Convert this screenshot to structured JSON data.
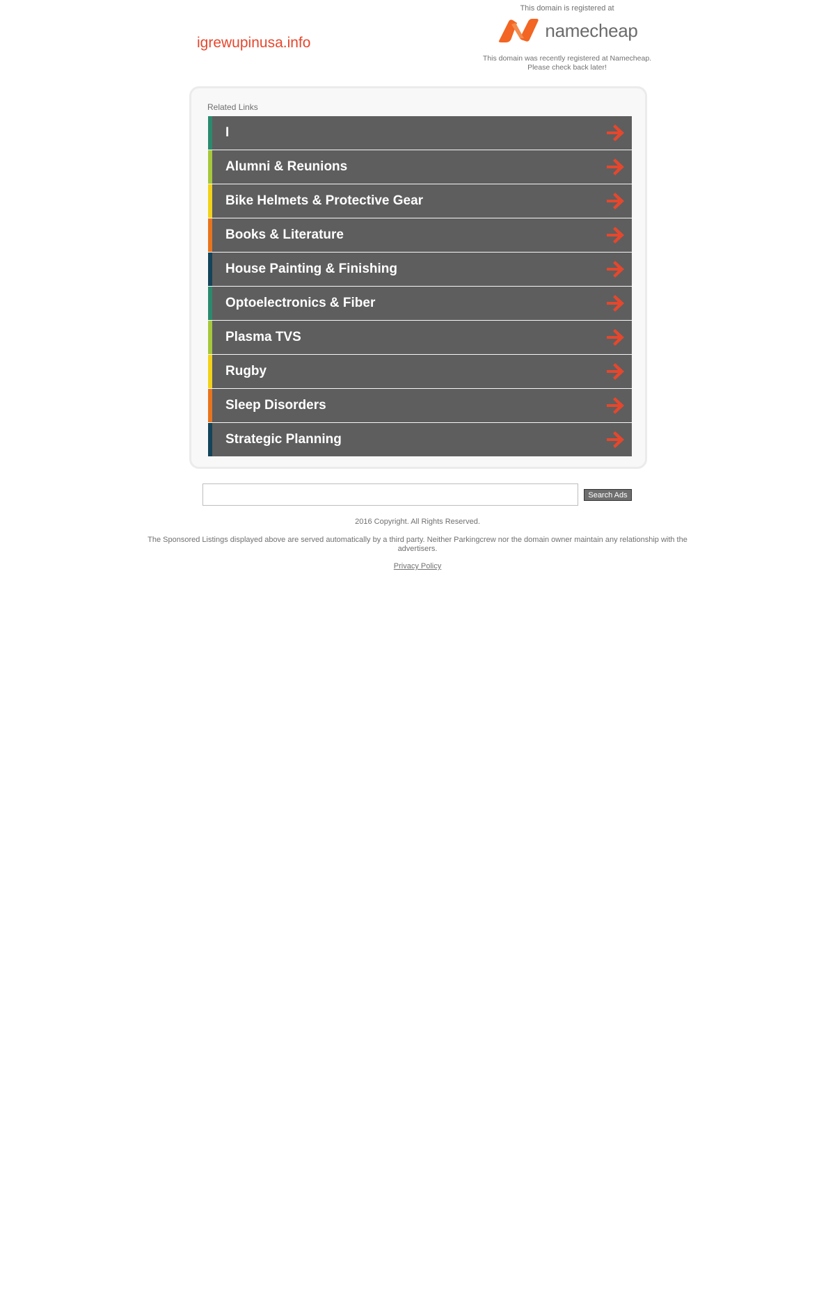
{
  "header": {
    "domain": "igrewupinusa.info",
    "registered_at": "This domain is registered at",
    "registrar_name": "namecheap",
    "notice_line1": "This domain was recently registered at Namecheap.",
    "notice_line2": "Please check back later!",
    "logo_icon": "namecheap-n-logo",
    "logo_color": "#f26522"
  },
  "related": {
    "title": "Related Links",
    "arrow_icon": "arrow-right-icon",
    "arrow_color": "#e5472d",
    "items": [
      {
        "label": "I",
        "color": "#2b8a6e"
      },
      {
        "label": "Alumni & Reunions",
        "color": "#a7c73c"
      },
      {
        "label": "Bike Helmets & Protective Gear",
        "color": "#f2d21b"
      },
      {
        "label": "Books & Literature",
        "color": "#e8741e"
      },
      {
        "label": "House Painting & Finishing",
        "color": "#13445a"
      },
      {
        "label": "Optoelectronics & Fiber",
        "color": "#2b8a6e"
      },
      {
        "label": "Plasma TVS",
        "color": "#a7c73c"
      },
      {
        "label": "Rugby",
        "color": "#f2d21b"
      },
      {
        "label": "Sleep Disorders",
        "color": "#e8741e"
      },
      {
        "label": "Strategic Planning",
        "color": "#13445a"
      }
    ]
  },
  "search": {
    "value": "",
    "button_label": "Search Ads"
  },
  "footer": {
    "copyright": "2016 Copyright. All Rights Reserved.",
    "disclaimer": "The Sponsored Listings displayed above are served automatically by a third party. Neither Parkingcrew nor the domain owner maintain any relationship with the advertisers.",
    "privacy_label": "Privacy Policy"
  }
}
